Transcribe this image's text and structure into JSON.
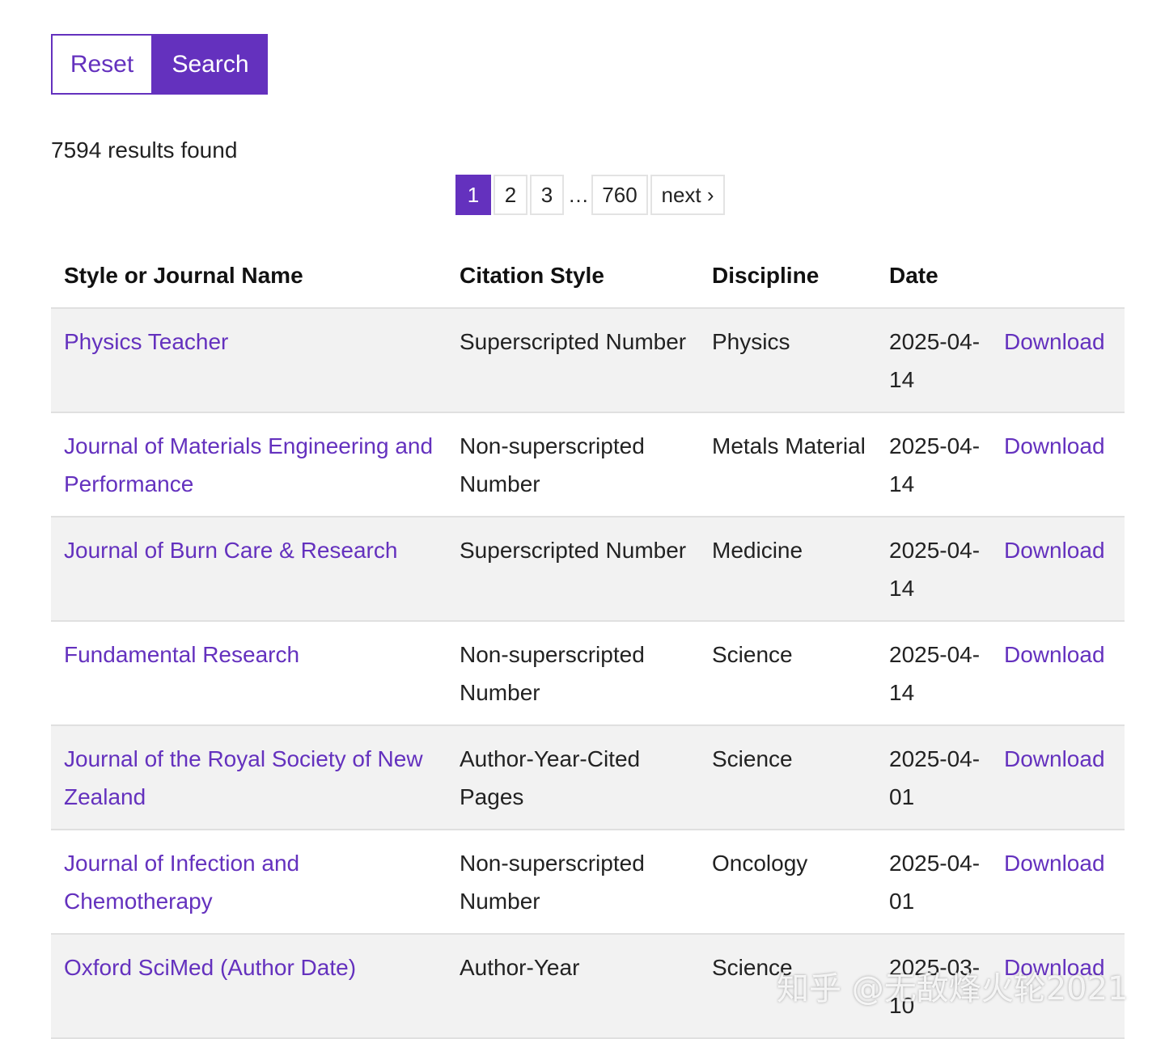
{
  "controls": {
    "reset_label": "Reset",
    "search_label": "Search"
  },
  "results_text": "7594 results found",
  "pagination": {
    "pages": [
      "1",
      "2",
      "3"
    ],
    "ellipsis": "…",
    "last": "760",
    "next": "next ›",
    "current": "1"
  },
  "table": {
    "headers": [
      "Style or Journal Name",
      "Citation Style",
      "Discipline",
      "Date"
    ],
    "rows": [
      {
        "name": "Physics Teacher",
        "style": "Superscripted Number",
        "discipline": "Physics",
        "date": "2025-04-14",
        "action": "Download"
      },
      {
        "name": "Journal of Materials Engineering and Performance",
        "style": "Non-superscripted Number",
        "discipline": "Metals Material",
        "date": "2025-04-14",
        "action": "Download"
      },
      {
        "name": "Journal of Burn Care & Research",
        "style": "Superscripted Number",
        "discipline": "Medicine",
        "date": "2025-04-14",
        "action": "Download"
      },
      {
        "name": "Fundamental Research",
        "style": "Non-superscripted Number",
        "discipline": "Science",
        "date": "2025-04-14",
        "action": "Download"
      },
      {
        "name": "Journal of the Royal Society of New Zealand",
        "style": "Author-Year-Cited Pages",
        "discipline": "Science",
        "date": "2025-04-01",
        "action": "Download"
      },
      {
        "name": "Journal of Infection and Chemotherapy",
        "style": "Non-superscripted Number",
        "discipline": "Oncology",
        "date": "2025-04-01",
        "action": "Download"
      },
      {
        "name": "Oxford SciMed (Author Date)",
        "style": "Author-Year",
        "discipline": "Science",
        "date": "2025-03-10",
        "action": "Download"
      }
    ]
  },
  "watermark": "知乎 @无敌烽火轮2021",
  "colors": {
    "accent": "#6431be",
    "row_shade": "#f2f2f2"
  }
}
